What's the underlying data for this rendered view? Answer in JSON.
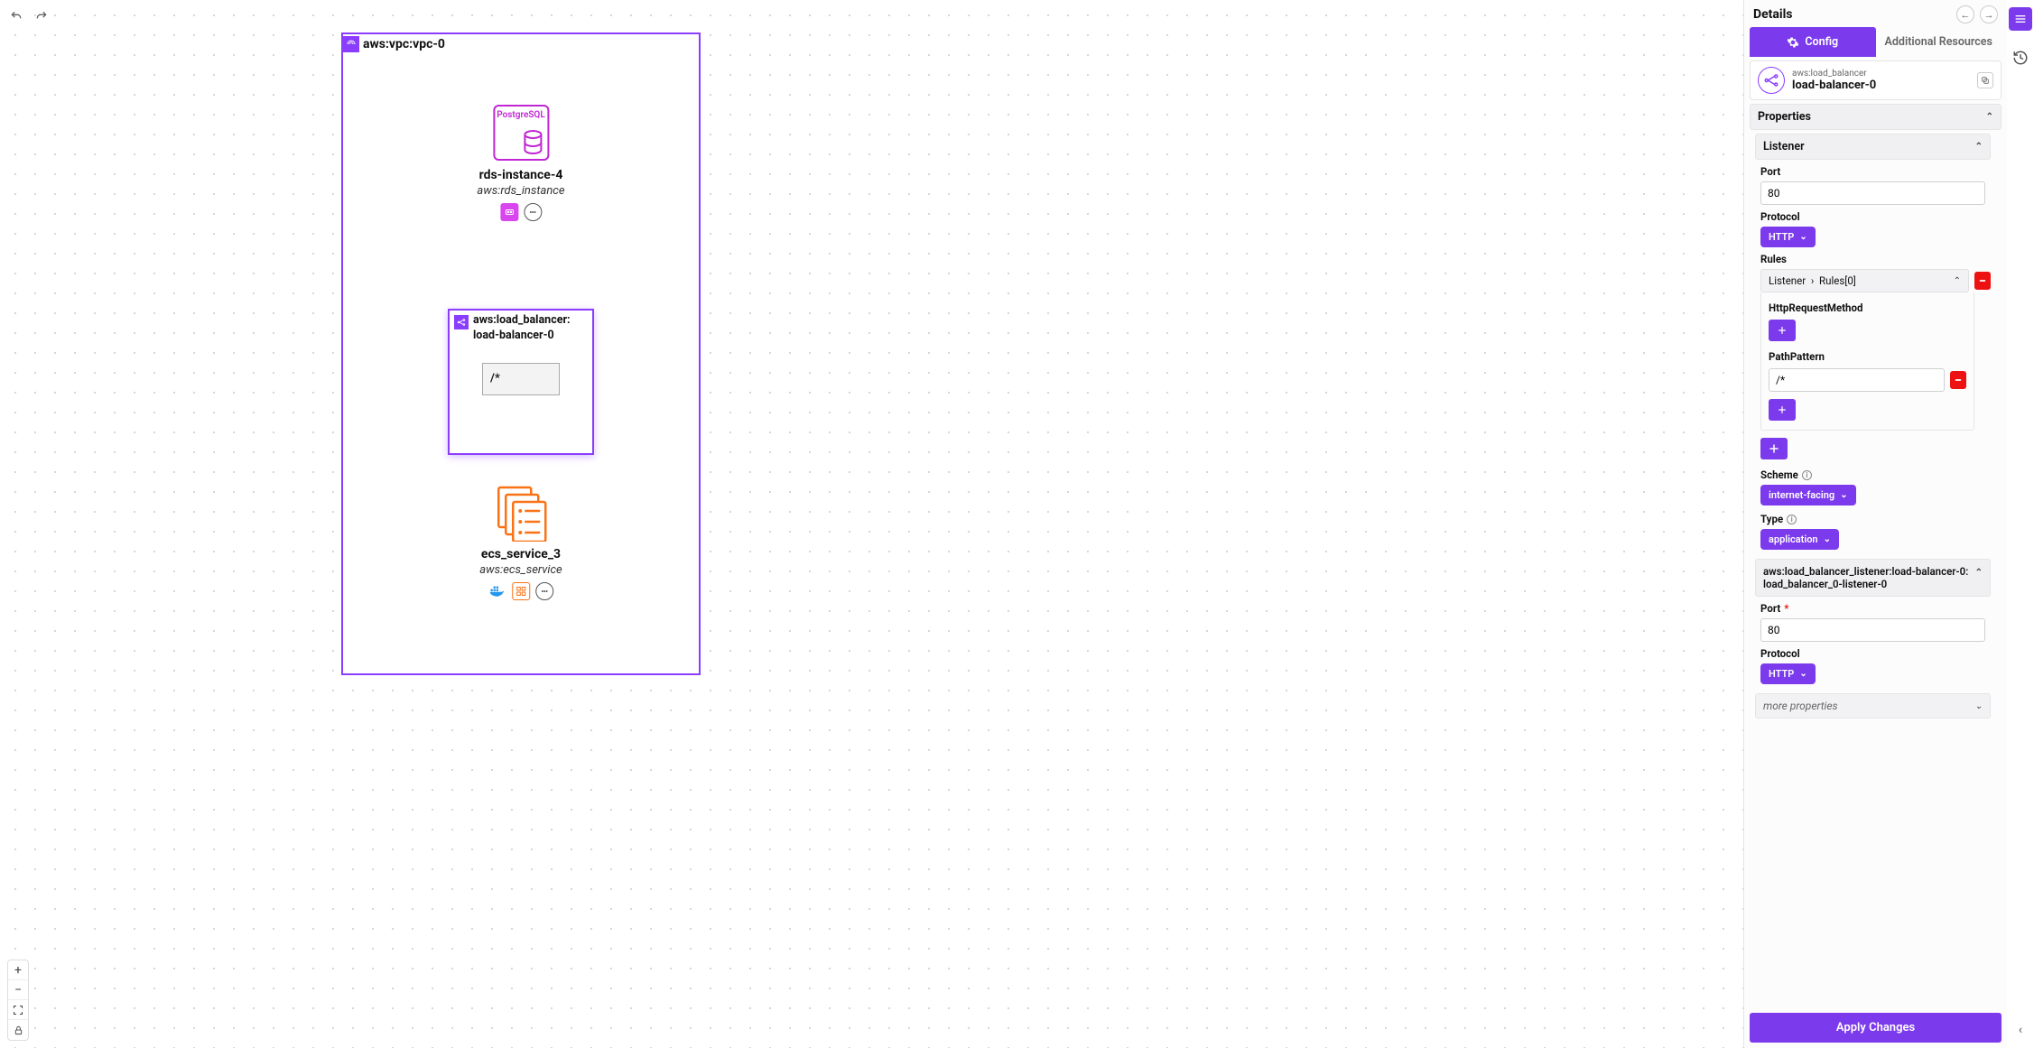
{
  "canvas": {
    "vpc_label": "aws:vpc:vpc-0",
    "rds": {
      "engine": "PostgreSQL",
      "name": "rds-instance-4",
      "type": "aws:rds_instance"
    },
    "lb": {
      "title_line1": "aws:load_balancer:",
      "title_line2": "load-balancer-0",
      "pattern": "/*"
    },
    "ecs": {
      "name": "ecs_service_3",
      "type": "aws:ecs_service"
    }
  },
  "details": {
    "title": "Details",
    "tabs": {
      "config": "Config",
      "additional": "Additional Resources"
    },
    "selected": {
      "type": "aws:load_balancer",
      "name": "load-balancer-0"
    },
    "properties_label": "Properties",
    "listener": {
      "label": "Listener",
      "port_label": "Port",
      "port_value": "80",
      "protocol_label": "Protocol",
      "protocol_value": "HTTP",
      "rules_label": "Rules",
      "rules_breadcrumb_a": "Listener",
      "rules_breadcrumb_b": "Rules[0]",
      "http_method_label": "HttpRequestMethod",
      "path_pattern_label": "PathPattern",
      "path_pattern_value": "/*"
    },
    "scheme": {
      "label": "Scheme",
      "value": "internet-facing"
    },
    "type": {
      "label": "Type",
      "value": "application"
    },
    "listener_res": {
      "label": "aws:load_balancer_listener:load-balancer-0:load_balancer_0-listener-0",
      "port_label": "Port",
      "port_value": "80",
      "protocol_label": "Protocol",
      "protocol_value": "HTTP"
    },
    "more_props": "more properties",
    "apply": "Apply Changes"
  }
}
